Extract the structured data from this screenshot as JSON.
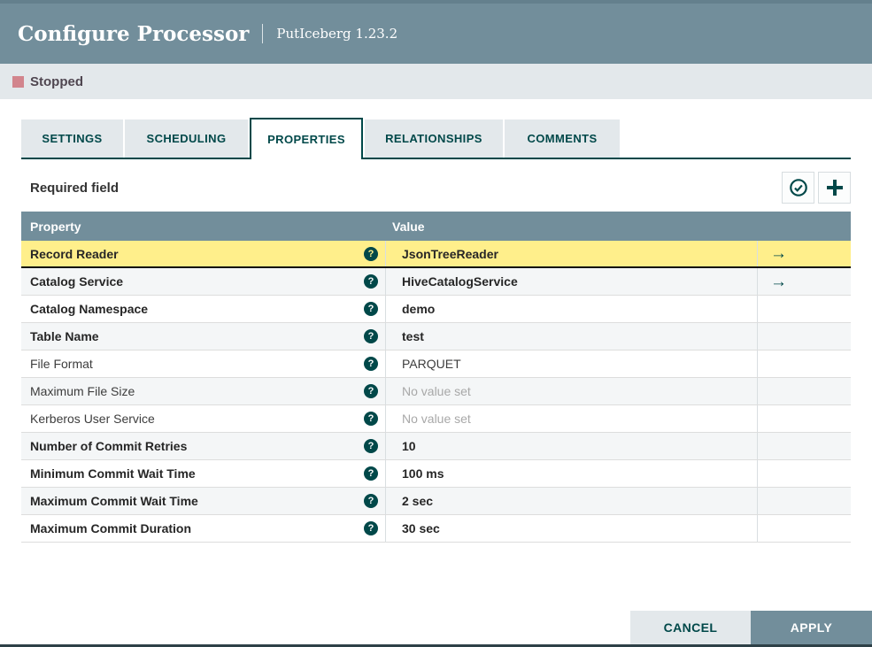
{
  "window": {
    "title": "Configure Processor",
    "subtitle": "PutIceberg 1.23.2"
  },
  "status": {
    "label": "Stopped"
  },
  "tabs": [
    {
      "label": "SETTINGS"
    },
    {
      "label": "SCHEDULING"
    },
    {
      "label": "PROPERTIES"
    },
    {
      "label": "RELATIONSHIPS"
    },
    {
      "label": "COMMENTS"
    }
  ],
  "active_tab": "PROPERTIES",
  "properties_panel": {
    "required_field_label": "Required field",
    "icons": {
      "verify": "check-circle-icon",
      "add": "plus-icon",
      "help": "question-circle-icon",
      "link": "go-to-arrow-icon"
    },
    "table": {
      "columns": [
        "Property",
        "Value"
      ],
      "rows": [
        {
          "property": "Record Reader",
          "value": "JsonTreeReader",
          "required": true,
          "selected": true,
          "has_link": true,
          "placeholder": false
        },
        {
          "property": "Catalog Service",
          "value": "HiveCatalogService",
          "required": true,
          "selected": false,
          "has_link": true,
          "placeholder": false
        },
        {
          "property": "Catalog Namespace",
          "value": "demo",
          "required": true,
          "selected": false,
          "has_link": false,
          "placeholder": false
        },
        {
          "property": "Table Name",
          "value": "test",
          "required": true,
          "selected": false,
          "has_link": false,
          "placeholder": false
        },
        {
          "property": "File Format",
          "value": "PARQUET",
          "required": false,
          "selected": false,
          "has_link": false,
          "placeholder": false
        },
        {
          "property": "Maximum File Size",
          "value": "No value set",
          "required": false,
          "selected": false,
          "has_link": false,
          "placeholder": true
        },
        {
          "property": "Kerberos User Service",
          "value": "No value set",
          "required": false,
          "selected": false,
          "has_link": false,
          "placeholder": true
        },
        {
          "property": "Number of Commit Retries",
          "value": "10",
          "required": true,
          "selected": false,
          "has_link": false,
          "placeholder": false
        },
        {
          "property": "Minimum Commit Wait Time",
          "value": "100 ms",
          "required": true,
          "selected": false,
          "has_link": false,
          "placeholder": false
        },
        {
          "property": "Maximum Commit Wait Time",
          "value": "2 sec",
          "required": true,
          "selected": false,
          "has_link": false,
          "placeholder": false
        },
        {
          "property": "Maximum Commit Duration",
          "value": "30 sec",
          "required": true,
          "selected": false,
          "has_link": false,
          "placeholder": false
        }
      ]
    }
  },
  "footer": {
    "cancel_label": "CANCEL",
    "apply_label": "APPLY"
  },
  "colors": {
    "header_bg": "#728e9b",
    "accent_teal": "#004849",
    "selected_row": "#ffef8b",
    "stopped_red": "#d2858d",
    "status_bg": "#e3e8eb"
  }
}
